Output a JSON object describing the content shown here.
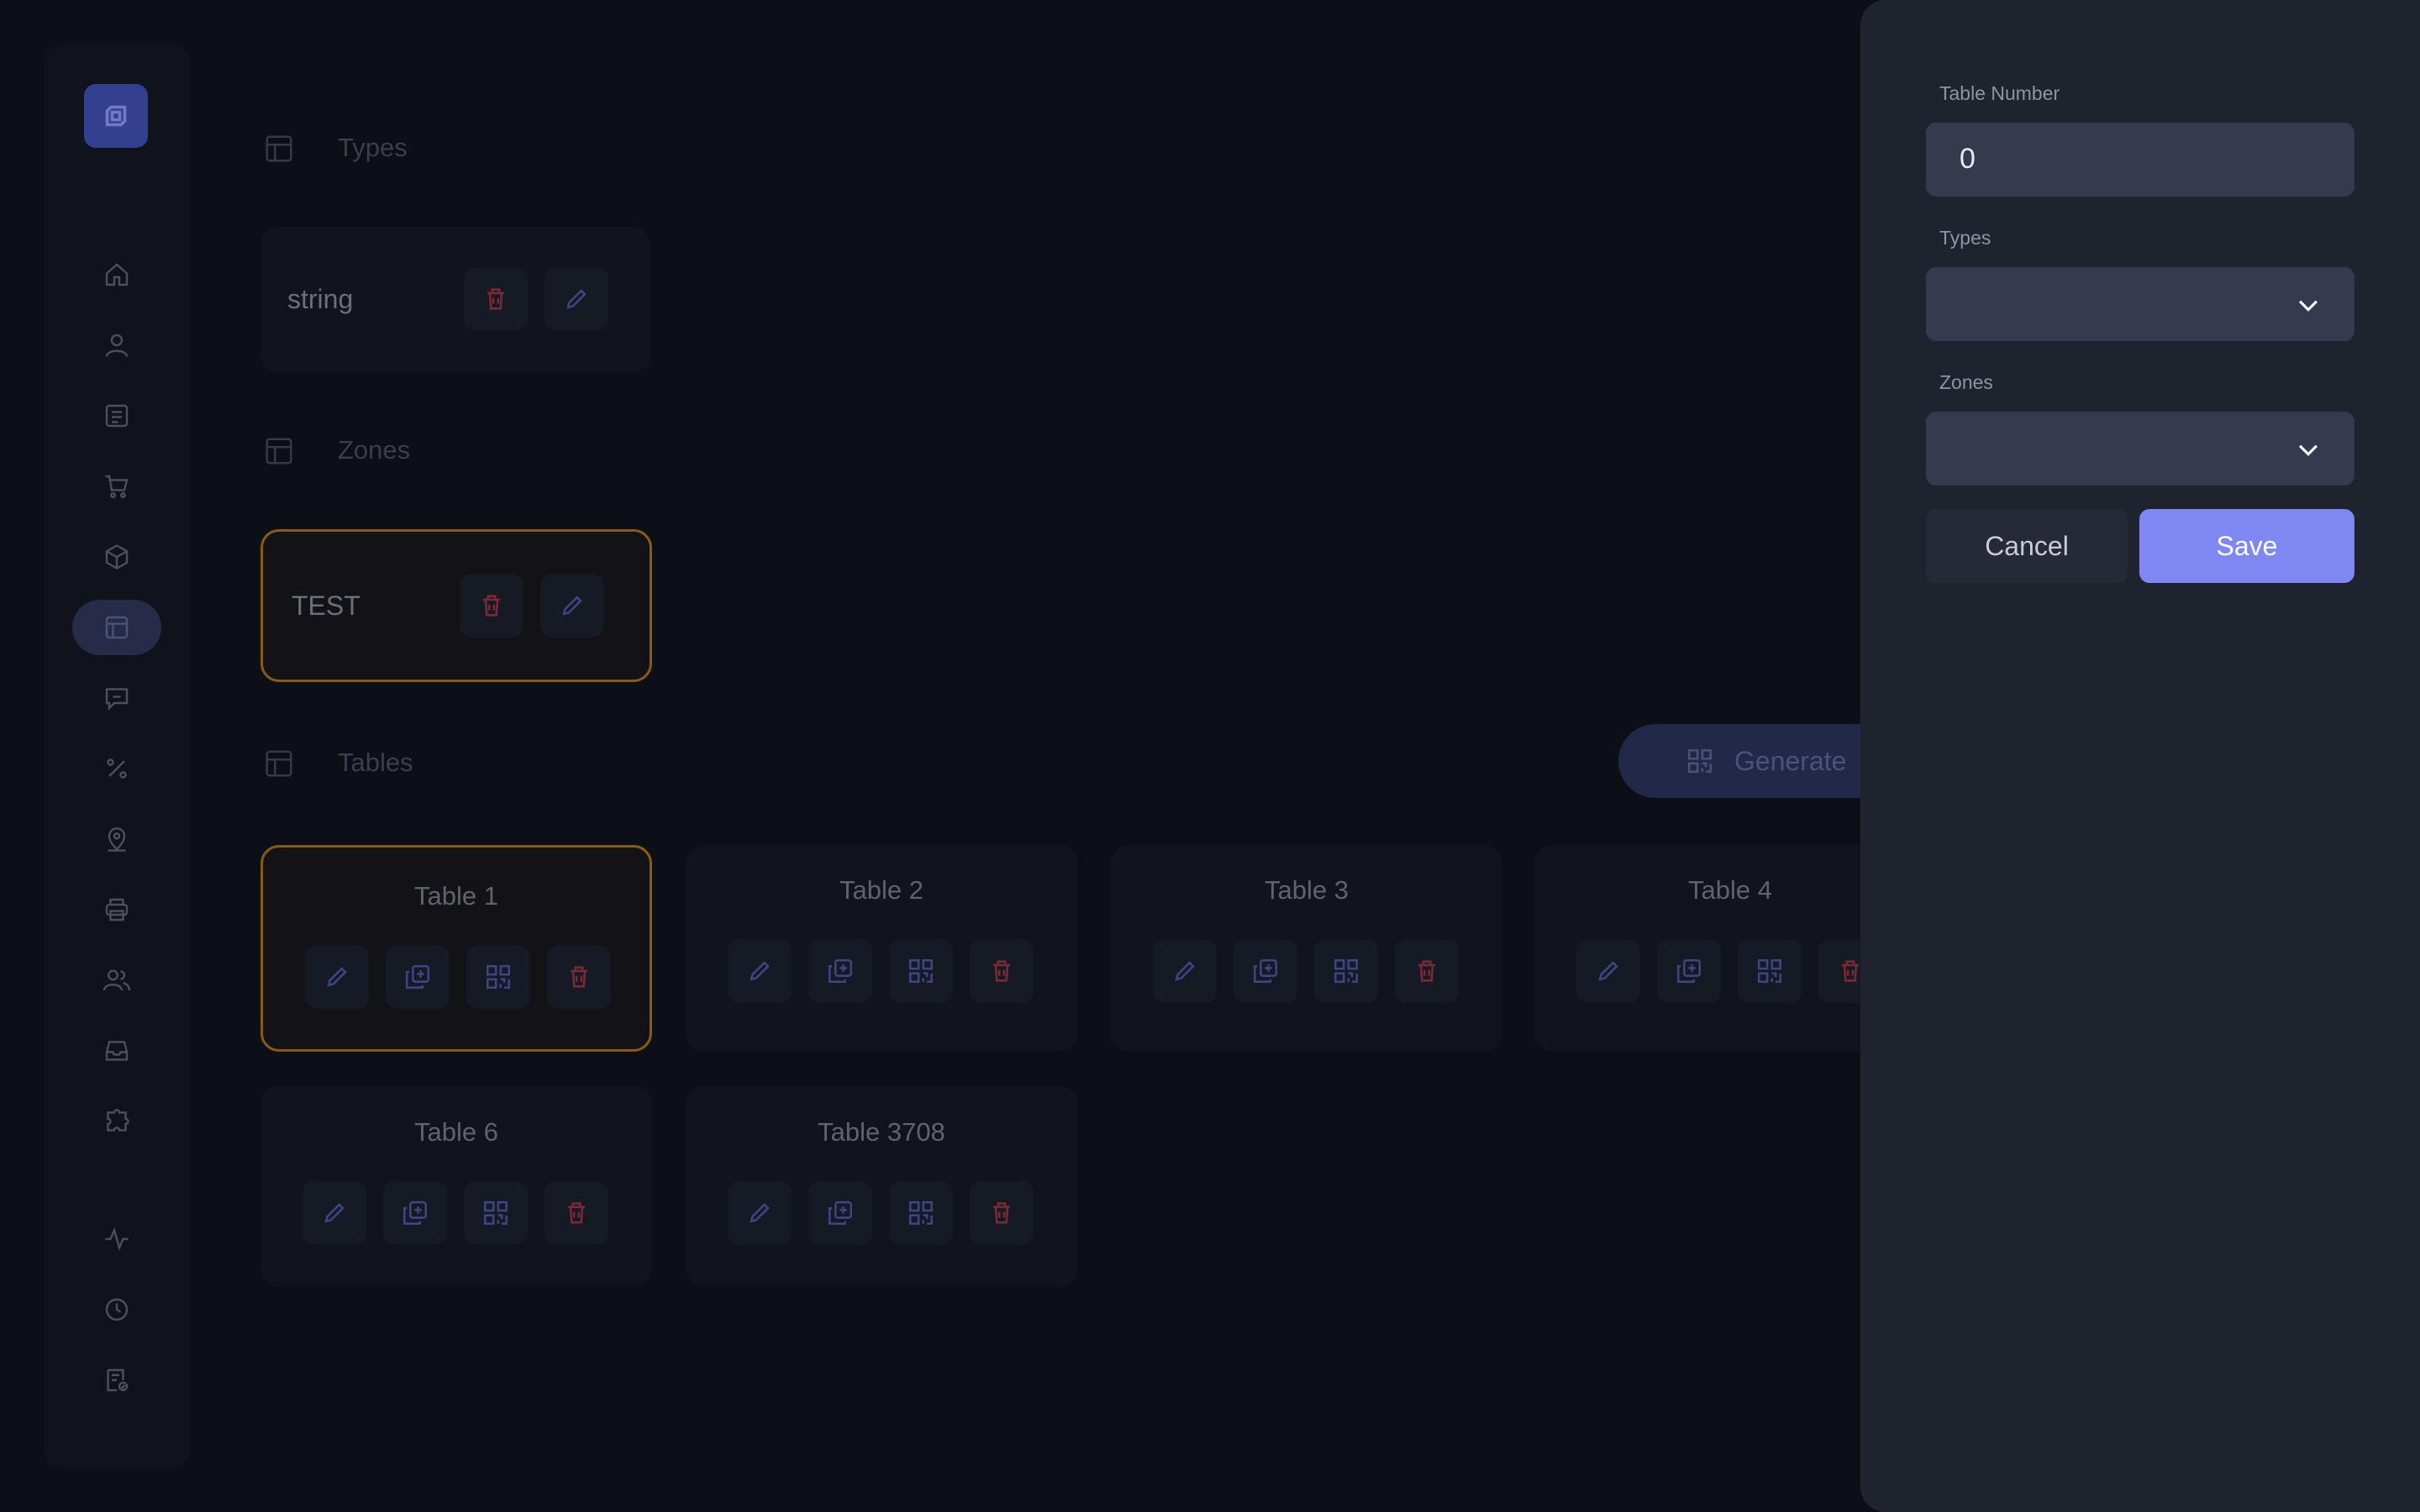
{
  "colors": {
    "accent": "#7f87f2",
    "danger": "#7a2a33",
    "selection_border": "#8a5a14",
    "drawer_bg": "#1f232e"
  },
  "sidebar": {
    "logo_icon": "logo-square-icon",
    "items": [
      {
        "icon": "home-icon",
        "active": false
      },
      {
        "icon": "user-icon",
        "active": false
      },
      {
        "icon": "list-icon",
        "active": false
      },
      {
        "icon": "cart-icon",
        "active": false
      },
      {
        "icon": "box-icon",
        "active": false
      },
      {
        "icon": "table-icon",
        "active": true
      },
      {
        "icon": "message-icon",
        "active": false
      },
      {
        "icon": "percent-icon",
        "active": false
      },
      {
        "icon": "location-icon",
        "active": false
      },
      {
        "icon": "printer-icon",
        "active": false
      },
      {
        "icon": "users-icon",
        "active": false
      },
      {
        "icon": "inbox-icon",
        "active": false
      },
      {
        "icon": "puzzle-icon",
        "active": false
      },
      {
        "icon": "activity-icon",
        "active": false
      },
      {
        "icon": "clock-icon",
        "active": false
      },
      {
        "icon": "report-icon",
        "active": false
      }
    ]
  },
  "sections": {
    "types": {
      "title": "Types",
      "items": [
        {
          "label": "string"
        }
      ]
    },
    "zones": {
      "title": "Zones",
      "items": [
        {
          "label": "TEST"
        }
      ]
    },
    "tables": {
      "title": "Tables",
      "generate_label": "Generate",
      "items": [
        {
          "name": "Table 1",
          "selected": true
        },
        {
          "name": "Table 2",
          "selected": false
        },
        {
          "name": "Table 3",
          "selected": false
        },
        {
          "name": "Table 4",
          "selected": false
        },
        {
          "name": "Table 6",
          "selected": false
        },
        {
          "name": "Table 3708",
          "selected": false
        }
      ]
    }
  },
  "drawer": {
    "table_number": {
      "label": "Table Number",
      "value": "0"
    },
    "types": {
      "label": "Types",
      "value": ""
    },
    "zones": {
      "label": "Zones",
      "value": ""
    },
    "cancel_label": "Cancel",
    "save_label": "Save"
  }
}
